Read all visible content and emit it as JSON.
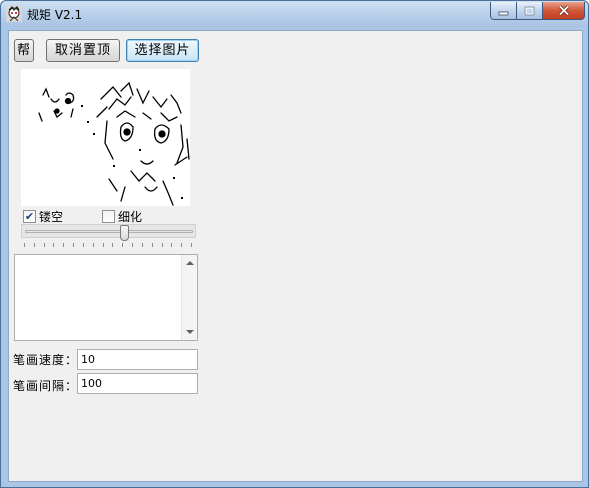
{
  "window": {
    "title": "规矩 V2.1"
  },
  "toolbar": {
    "help_label": "帮",
    "unpin_label": "取消置顶",
    "select_image_label": "选择图片"
  },
  "options": {
    "hollow": {
      "label": "镂空",
      "checked": true
    },
    "thin": {
      "label": "细化",
      "checked": false
    }
  },
  "slider": {
    "value_fraction": 0.6
  },
  "settings": {
    "stroke_speed_label": "笔画速度：",
    "stroke_speed_value": "10",
    "stroke_interval_label": "笔画间隔：",
    "stroke_interval_value": "100"
  },
  "memo": {
    "text": ""
  }
}
